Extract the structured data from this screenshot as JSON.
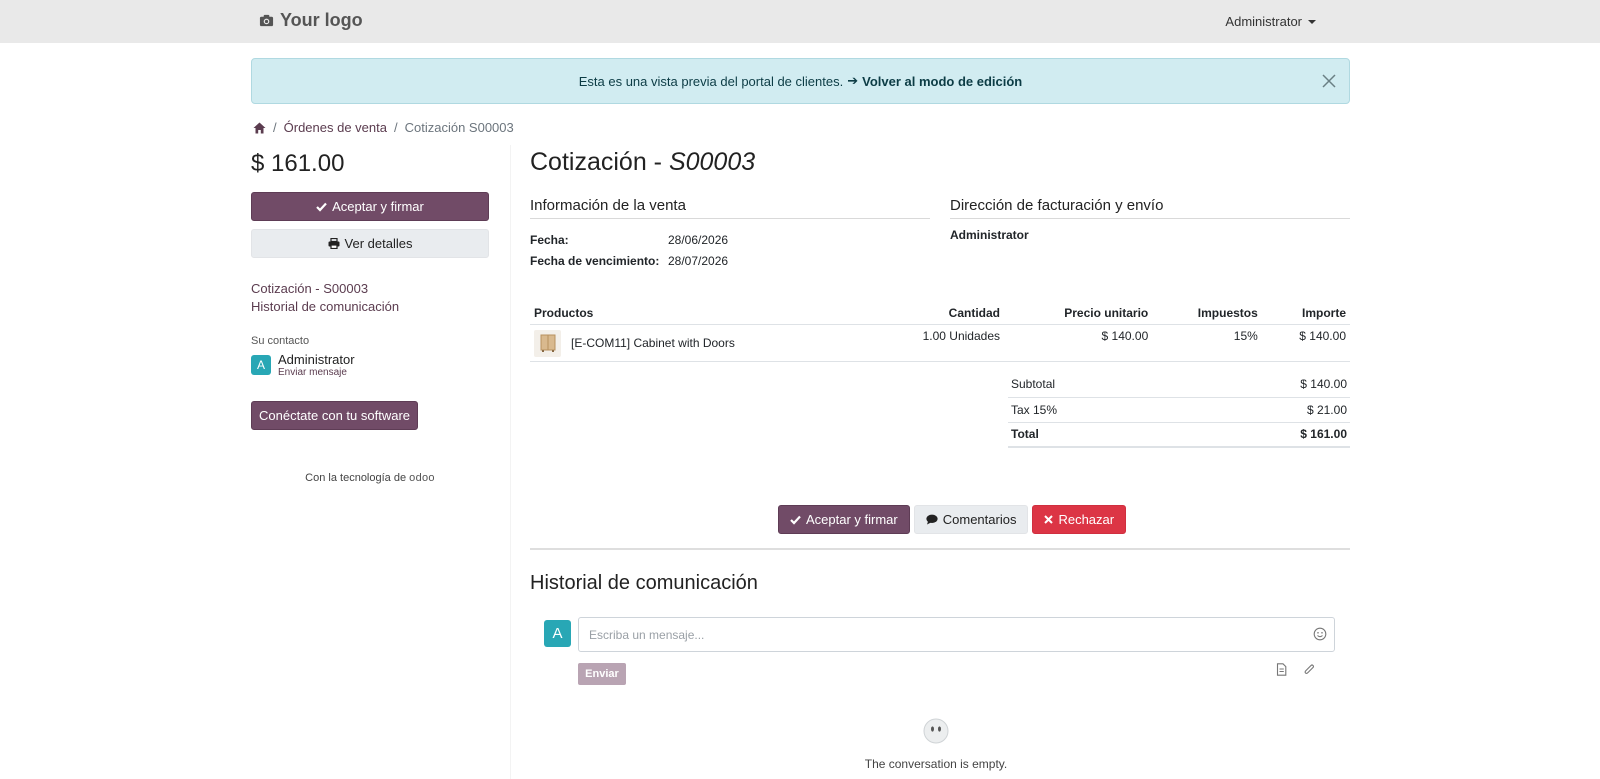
{
  "header": {
    "logo_text": "Your logo",
    "user_name": "Administrator"
  },
  "alert": {
    "message": "Esta es una vista previa del portal de clientes.",
    "arrow": "➔",
    "link_label": "Volver al modo de edición"
  },
  "breadcrumb": {
    "sep": "/",
    "orders_label": "Órdenes de venta",
    "current": "Cotización S00003"
  },
  "sidebar": {
    "total": "$ 161.00",
    "accept_label": "Aceptar y firmar",
    "details_label": "Ver detalles",
    "nav": [
      "Cotización - S00003",
      "Historial de comunicación"
    ],
    "contact_label": "Su contacto",
    "contact_initial": "A",
    "contact_name": "Administrator",
    "contact_message": "Enviar mensaje",
    "connect_label": "Conéctate con tu software",
    "powered_text": "Con la tecnología de",
    "powered_brand": "odoo"
  },
  "quote": {
    "title_prefix": "Cotización -",
    "title_ref": "S00003",
    "sales_info_title": "Información de la venta",
    "billing_title": "Dirección de facturación y envío",
    "billing_name": "Administrator",
    "date_label": "Fecha:",
    "date_value": "28/06/2026",
    "due_label": "Fecha de vencimiento:",
    "due_value": "28/07/2026"
  },
  "products_table": {
    "headers": [
      "Productos",
      "Cantidad",
      "Precio unitario",
      "Impuestos",
      "Importe"
    ],
    "rows": [
      {
        "name": "[E-COM11] Cabinet with Doors",
        "qty": "1.00 Unidades",
        "unit_price": "$ 140.00",
        "taxes": "15%",
        "amount": "$ 140.00"
      }
    ]
  },
  "totals": {
    "subtotal_label": "Subtotal",
    "subtotal_value": "$ 140.00",
    "tax_label": "Tax 15%",
    "tax_value": "$ 21.00",
    "total_label": "Total",
    "total_value": "$ 161.00"
  },
  "actions": {
    "accept_label": "Aceptar y firmar",
    "comments_label": "Comentarios",
    "reject_label": "Rechazar"
  },
  "history": {
    "title": "Historial de comunicación",
    "avatar_initial": "A",
    "input_placeholder": "Escriba un mensaje...",
    "send_label": "Enviar",
    "empty_text": "The conversation is empty."
  },
  "colors": {
    "primary": "#714b67",
    "alert_bg": "#d1ecf1",
    "danger": "#dc3545",
    "avatar": "#28a7b5",
    "topbar": "#e9e9e9"
  },
  "icons": [
    "camera-icon",
    "caret-down-icon",
    "close-icon",
    "home-icon",
    "check-icon",
    "print-icon",
    "comment-icon",
    "times-icon",
    "emoji-icon",
    "document-icon",
    "paperclip-icon",
    "empty-face-icon"
  ]
}
